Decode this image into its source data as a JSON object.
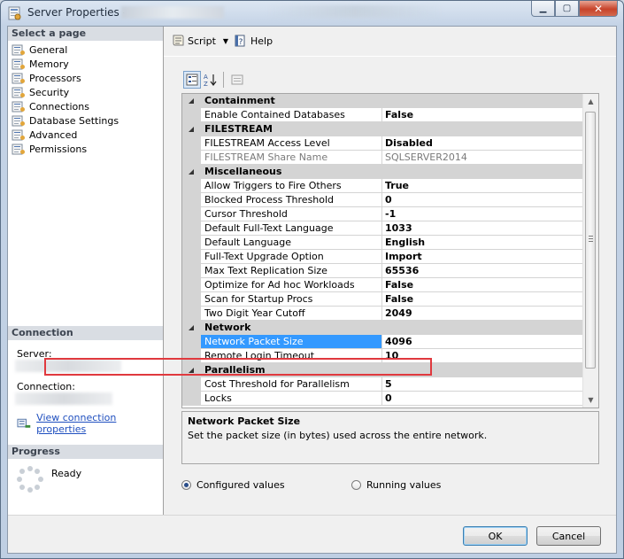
{
  "window": {
    "title": "Server Properties -"
  },
  "left": {
    "select_page_header": "Select a page",
    "pages": [
      {
        "label": "General"
      },
      {
        "label": "Memory"
      },
      {
        "label": "Processors"
      },
      {
        "label": "Security"
      },
      {
        "label": "Connections"
      },
      {
        "label": "Database Settings"
      },
      {
        "label": "Advanced"
      },
      {
        "label": "Permissions"
      }
    ],
    "connection_header": "Connection",
    "server_label": "Server:",
    "connection_label": "Connection:",
    "view_connection_link": "View connection properties",
    "progress_header": "Progress",
    "progress_status": "Ready"
  },
  "toolbar": {
    "script_label": "Script",
    "help_label": "Help"
  },
  "grid": {
    "rows": [
      {
        "type": "category",
        "name": "Containment"
      },
      {
        "type": "prop",
        "name": "Enable Contained Databases",
        "value": "False"
      },
      {
        "type": "category",
        "name": "FILESTREAM"
      },
      {
        "type": "prop",
        "name": "FILESTREAM Access Level",
        "value": "Disabled"
      },
      {
        "type": "prop",
        "name": "FILESTREAM Share Name",
        "value": "SQLSERVER2014",
        "readonly": true
      },
      {
        "type": "category",
        "name": "Miscellaneous"
      },
      {
        "type": "prop",
        "name": "Allow Triggers to Fire Others",
        "value": "True"
      },
      {
        "type": "prop",
        "name": "Blocked Process Threshold",
        "value": "0"
      },
      {
        "type": "prop",
        "name": "Cursor Threshold",
        "value": "-1"
      },
      {
        "type": "prop",
        "name": "Default Full-Text Language",
        "value": "1033"
      },
      {
        "type": "prop",
        "name": "Default Language",
        "value": "English"
      },
      {
        "type": "prop",
        "name": "Full-Text Upgrade Option",
        "value": "Import"
      },
      {
        "type": "prop",
        "name": "Max Text Replication Size",
        "value": "65536"
      },
      {
        "type": "prop",
        "name": "Optimize for Ad hoc Workloads",
        "value": "False"
      },
      {
        "type": "prop",
        "name": "Scan for Startup Procs",
        "value": "False"
      },
      {
        "type": "prop",
        "name": "Two Digit Year Cutoff",
        "value": "2049"
      },
      {
        "type": "category",
        "name": "Network"
      },
      {
        "type": "prop",
        "name": "Network Packet Size",
        "value": "4096",
        "selected": true
      },
      {
        "type": "prop",
        "name": "Remote Login Timeout",
        "value": "10"
      },
      {
        "type": "category",
        "name": "Parallelism"
      },
      {
        "type": "prop",
        "name": "Cost Threshold for Parallelism",
        "value": "5"
      },
      {
        "type": "prop",
        "name": "Locks",
        "value": "0"
      }
    ]
  },
  "description": {
    "title": "Network Packet Size",
    "text": "Set the packet size (in bytes) used across the entire network."
  },
  "options": {
    "configured_label": "Configured values",
    "running_label": "Running values"
  },
  "buttons": {
    "ok_label": "OK",
    "cancel_label": "Cancel"
  },
  "colors": {
    "selection": "#3399ff",
    "highlight_border": "#e0393e",
    "link": "#1f4fbf"
  }
}
